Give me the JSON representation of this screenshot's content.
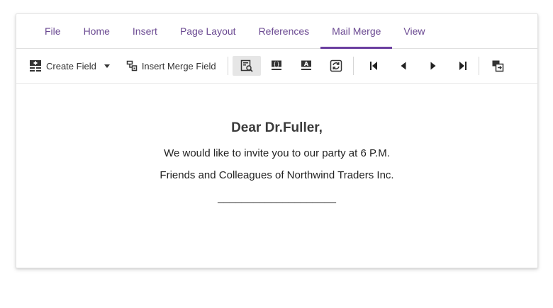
{
  "ribbon": {
    "tabs": [
      {
        "label": "File"
      },
      {
        "label": "Home"
      },
      {
        "label": "Insert"
      },
      {
        "label": "Page Layout"
      },
      {
        "label": "References"
      },
      {
        "label": "Mail Merge",
        "active": true
      },
      {
        "label": "View"
      }
    ]
  },
  "toolbar": {
    "create_field": {
      "label": "Create Field",
      "icon": "create-field-icon"
    },
    "insert_merge_field": {
      "label": "Insert Merge Field",
      "icon": "insert-merge-field-icon"
    },
    "icons": [
      "preview-results-icon",
      "show-field-codes-icon",
      "highlight-fields-icon",
      "update-fields-icon",
      "first-record-icon",
      "previous-record-icon",
      "next-record-icon",
      "last-record-icon",
      "finish-merge-icon"
    ]
  },
  "document": {
    "greeting": "Dear Dr.Fuller,",
    "line1": "We would like to invite you to our party at 6 P.M.",
    "line2": "Friends and Colleagues of Northwind Traders Inc.",
    "signature": "____________________"
  },
  "colors": {
    "accent": "#6b3fa0",
    "tab_text": "#6b4a92",
    "pressed_bg": "#e6e6e6"
  }
}
